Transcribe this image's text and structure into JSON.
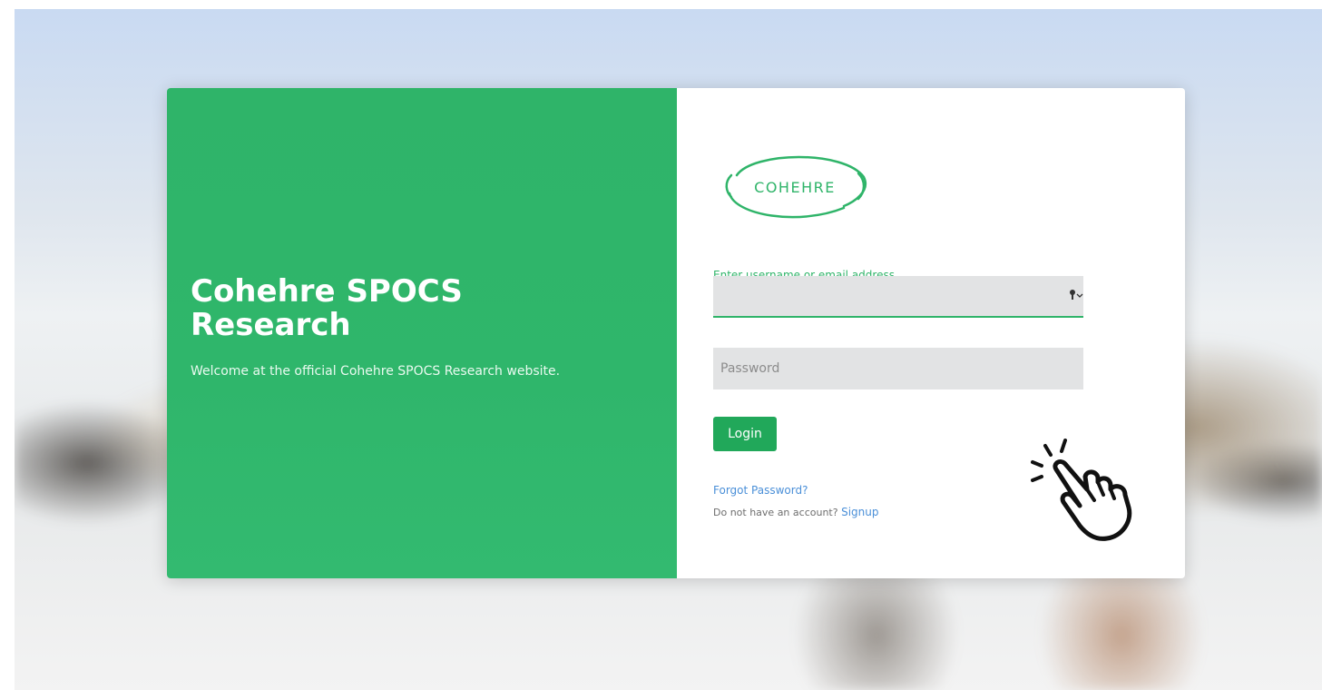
{
  "hero": {
    "title_line1": "Cohehre SPOCS",
    "title_line2": "Research",
    "welcome": "Welcome at the official Cohehre SPOCS Research website."
  },
  "logo": {
    "text": "COHEHRE"
  },
  "form": {
    "username_label": "Enter username or email address",
    "username_value": "",
    "password_placeholder": "Password",
    "password_value": "",
    "login_label": "Login",
    "forgot_label": "Forgot Password?",
    "no_account_text": "Do not have an account?",
    "signup_label": "Signup"
  },
  "icons": {
    "autofill": "key-icon",
    "cursor": "hand-pointer-icon"
  },
  "colors": {
    "brand_green": "#2fb469",
    "button_green": "#21a85a",
    "link_blue": "#4a8fd8"
  }
}
